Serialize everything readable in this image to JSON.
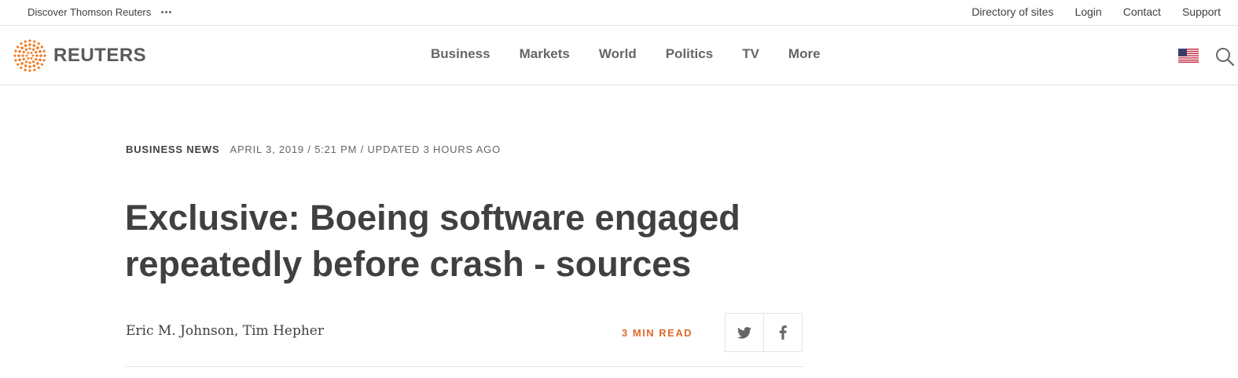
{
  "utility": {
    "discover_label": "Discover Thomson Reuters",
    "links": [
      "Directory of sites",
      "Login",
      "Contact",
      "Support"
    ]
  },
  "brand": {
    "name": "REUTERS",
    "accent": "#f47b20"
  },
  "nav": {
    "items": [
      "Business",
      "Markets",
      "World",
      "Politics",
      "TV",
      "More"
    ]
  },
  "article": {
    "section": "BUSINESS NEWS",
    "dateline": "APRIL 3, 2019 / 5:21 PM / UPDATED 3 HOURS AGO",
    "headline": "Exclusive: Boeing software engaged repeatedly before crash - sources",
    "byline": "Eric M. Johnson, Tim Hepher",
    "read_time": "3 MIN READ",
    "read_time_color": "#e06a2c"
  },
  "icons": {
    "menu": "more-dots-icon",
    "edition": "us-flag-icon",
    "search": "search-icon",
    "share": [
      "twitter-icon",
      "facebook-icon"
    ]
  }
}
